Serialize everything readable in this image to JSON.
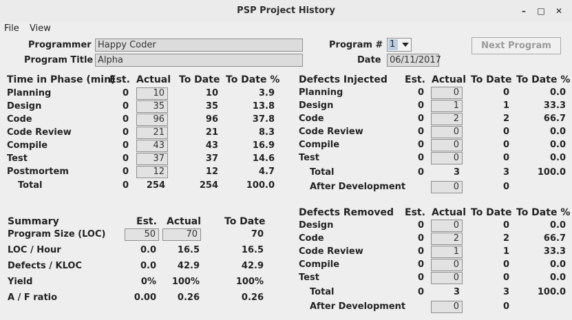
{
  "window": {
    "title": "PSP Project History"
  },
  "menu": [
    "File",
    "View"
  ],
  "header": {
    "programmer_label": "Programmer",
    "programmer": "Happy Coder",
    "program_title_label": "Program Title",
    "program_title": "Alpha",
    "program_no_label": "Program #",
    "program_no": "1",
    "date_label": "Date",
    "date": "06/11/2017",
    "next_button": "Next Program"
  },
  "time": {
    "title": "Time in Phase (min)",
    "cols": [
      "Est.",
      "Actual",
      "To Date",
      "To Date %"
    ],
    "rows": [
      {
        "name": "Planning",
        "est": "0",
        "actual": "10",
        "to_date": "10",
        "pct": "3.9"
      },
      {
        "name": "Design",
        "est": "0",
        "actual": "35",
        "to_date": "35",
        "pct": "13.8"
      },
      {
        "name": "Code",
        "est": "0",
        "actual": "96",
        "to_date": "96",
        "pct": "37.8"
      },
      {
        "name": "Code Review",
        "est": "0",
        "actual": "21",
        "to_date": "21",
        "pct": "8.3"
      },
      {
        "name": "Compile",
        "est": "0",
        "actual": "43",
        "to_date": "43",
        "pct": "16.9"
      },
      {
        "name": "Test",
        "est": "0",
        "actual": "37",
        "to_date": "37",
        "pct": "14.6"
      },
      {
        "name": "Postmortem",
        "est": "0",
        "actual": "12",
        "to_date": "12",
        "pct": "4.7"
      }
    ],
    "total": {
      "name": "Total",
      "est": "0",
      "actual": "254",
      "to_date": "254",
      "pct": "100.0"
    }
  },
  "summary": {
    "title": "Summary",
    "cols": [
      "Est.",
      "Actual",
      "To Date"
    ],
    "rows": [
      {
        "name": "Program Size (LOC)",
        "est": "50",
        "actual": "70",
        "to_date": "70"
      },
      {
        "name": "LOC / Hour",
        "est": "0.0",
        "actual": "16.5",
        "to_date": "16.5"
      },
      {
        "name": "Defects / KLOC",
        "est": "0.0",
        "actual": "42.9",
        "to_date": "42.9"
      },
      {
        "name": "Yield",
        "est": "0%",
        "actual": "100%",
        "to_date": "100%"
      },
      {
        "name": "A / F ratio",
        "est": "0.00",
        "actual": "0.26",
        "to_date": "0.26"
      }
    ]
  },
  "injected": {
    "title": "Defects Injected",
    "cols": [
      "Est.",
      "Actual",
      "To Date",
      "To Date %"
    ],
    "rows": [
      {
        "name": "Planning",
        "est": "0",
        "actual": "0",
        "to_date": "0",
        "pct": "0.0"
      },
      {
        "name": "Design",
        "est": "0",
        "actual": "1",
        "to_date": "1",
        "pct": "33.3"
      },
      {
        "name": "Code",
        "est": "0",
        "actual": "2",
        "to_date": "2",
        "pct": "66.7"
      },
      {
        "name": "Code Review",
        "est": "0",
        "actual": "0",
        "to_date": "0",
        "pct": "0.0"
      },
      {
        "name": "Compile",
        "est": "0",
        "actual": "0",
        "to_date": "0",
        "pct": "0.0"
      },
      {
        "name": "Test",
        "est": "0",
        "actual": "0",
        "to_date": "0",
        "pct": "0.0"
      }
    ],
    "total": {
      "name": "Total",
      "est": "0",
      "actual": "3",
      "to_date": "3",
      "pct": "100.0"
    },
    "after": {
      "name": "After Development",
      "actual": "0",
      "to_date": "0"
    }
  },
  "removed": {
    "title": "Defects Removed",
    "cols": [
      "Est.",
      "Actual",
      "To Date",
      "To Date %"
    ],
    "rows": [
      {
        "name": "Design",
        "est": "0",
        "actual": "0",
        "to_date": "0",
        "pct": "0.0"
      },
      {
        "name": "Code",
        "est": "0",
        "actual": "2",
        "to_date": "2",
        "pct": "66.7"
      },
      {
        "name": "Code Review",
        "est": "0",
        "actual": "1",
        "to_date": "1",
        "pct": "33.3"
      },
      {
        "name": "Compile",
        "est": "0",
        "actual": "0",
        "to_date": "0",
        "pct": "0.0"
      },
      {
        "name": "Test",
        "est": "0",
        "actual": "0",
        "to_date": "0",
        "pct": "0.0"
      }
    ],
    "total": {
      "name": "Total",
      "est": "0",
      "actual": "3",
      "to_date": "3",
      "pct": "100.0"
    },
    "after": {
      "name": "After Development",
      "actual": "0",
      "to_date": "0"
    }
  }
}
